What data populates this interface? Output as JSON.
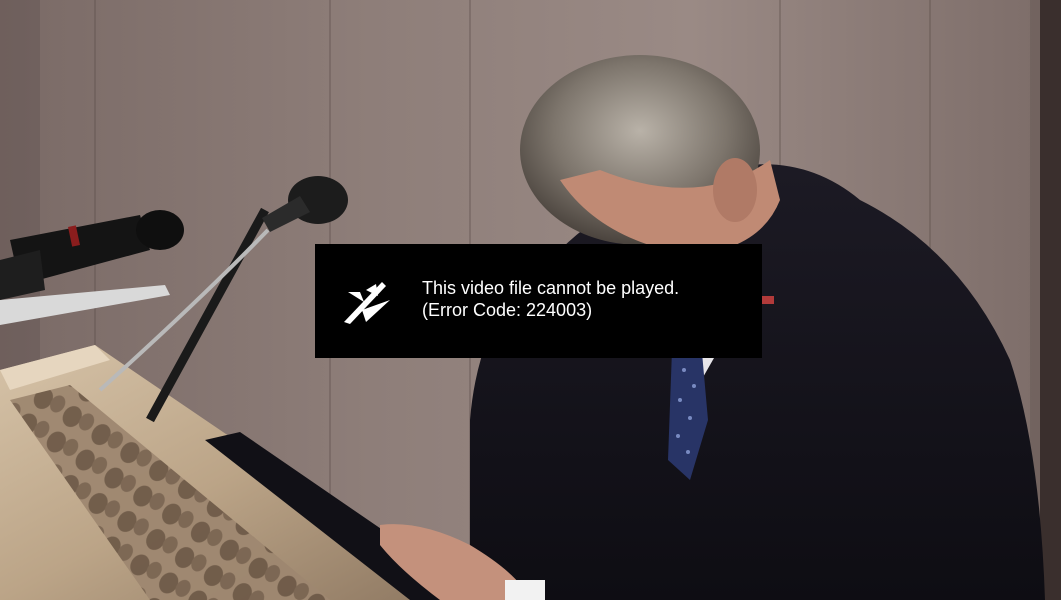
{
  "video_player": {
    "poster_alt": "Man in dark suit bowing his head at a lectern with microphones",
    "error": {
      "icon": "broken-play-icon",
      "message_line1": "This video file cannot be played.",
      "message_line2": "(Error Code: 224003)"
    }
  },
  "colors": {
    "error_background": "#000000",
    "error_text": "#ffffff"
  }
}
